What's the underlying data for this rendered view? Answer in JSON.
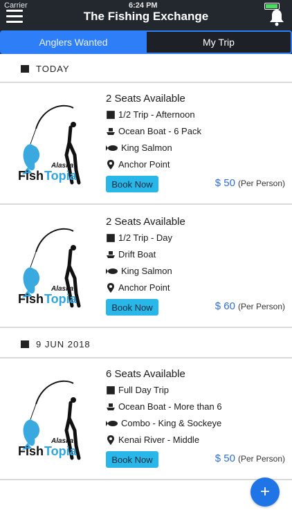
{
  "status": {
    "carrier": "Carrier",
    "time": "6:24 PM"
  },
  "header": {
    "title": "The Fishing Exchange"
  },
  "tabs": [
    {
      "label": "Anglers Wanted",
      "active": true
    },
    {
      "label": "My Trip",
      "active": false
    }
  ],
  "sections": [
    {
      "date": "TODAY"
    },
    {
      "date": "9 JUN 2018"
    }
  ],
  "trips": [
    {
      "seats": "2 Seats Available",
      "trip": "1/2 Trip - Afternoon",
      "boat": "Ocean Boat - 6 Pack",
      "fish": "King Salmon",
      "location": "Anchor Point",
      "book": "Book Now",
      "price": "$ 50",
      "per": "(Per Person)"
    },
    {
      "seats": "2 Seats Available",
      "trip": "1/2 Trip - Day",
      "boat": "Drift Boat",
      "fish": "King Salmon",
      "location": "Anchor Point",
      "book": "Book Now",
      "price": "$ 60",
      "per": "(Per Person)"
    },
    {
      "seats": "6 Seats Available",
      "trip": "Full Day Trip",
      "boat": "Ocean Boat - More than 6",
      "fish": "Combo - King & Sockeye",
      "location": "Kenai River - Middle",
      "book": "Book Now",
      "price": "$ 50",
      "per": "(Per Person)"
    }
  ],
  "logo": {
    "line1": "Alaska",
    "word_a": "Fish",
    "word_b": "Topia"
  },
  "fab": {
    "label": "+"
  },
  "colors": {
    "header": "#23272e",
    "accent": "#2d7ef7",
    "button": "#29b6e8",
    "price": "#2d6fd6",
    "fab": "#1f74e6"
  }
}
